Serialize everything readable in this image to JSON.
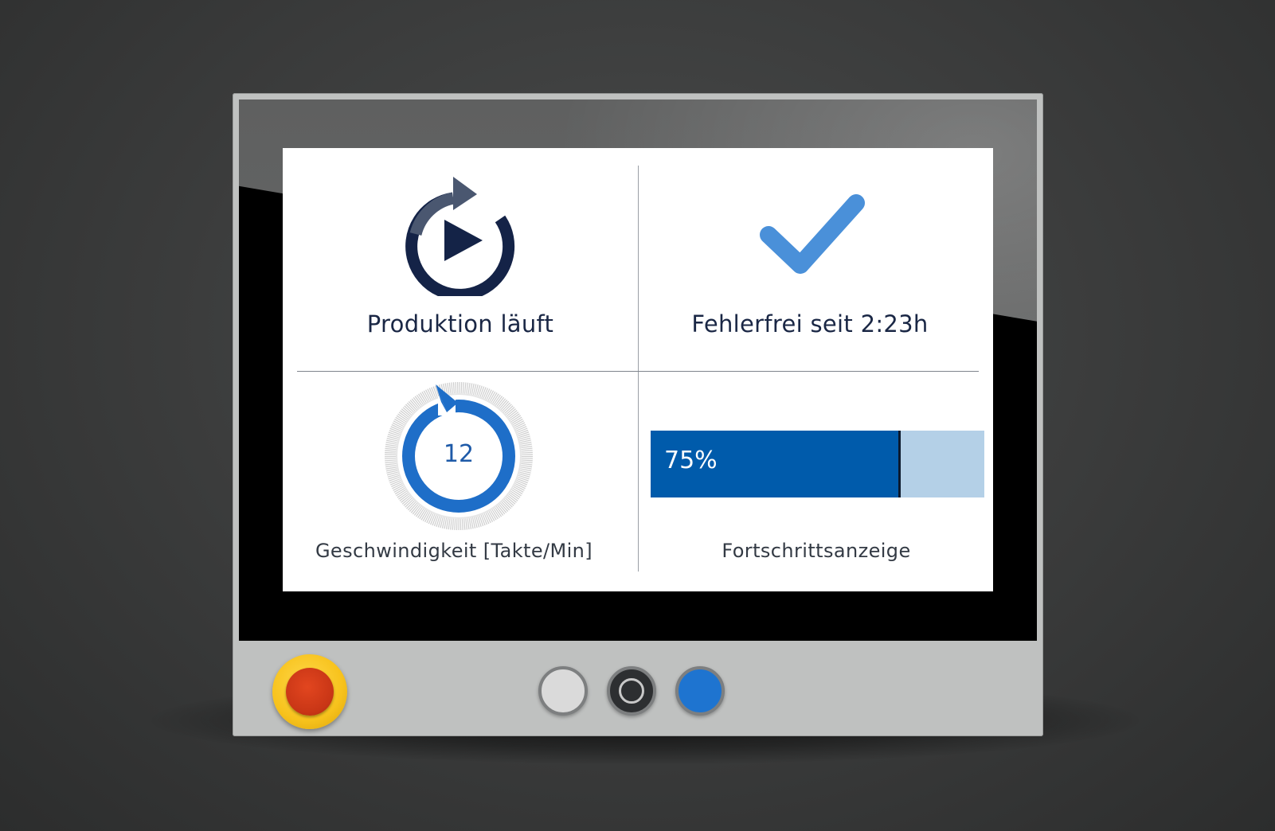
{
  "status": {
    "production_label": "Produktion läuft",
    "production_icon": "replay-play-icon",
    "error_free_label": "Fehlerfrei seit 2:23h",
    "error_free_icon": "checkmark-icon"
  },
  "speed": {
    "value": "12",
    "caption": "Geschwindigkeit [Takte/Min]"
  },
  "progress": {
    "value_percent": 75,
    "label": "75%",
    "caption": "Fortschrittsanzeige"
  },
  "hardware_buttons": [
    {
      "name": "emergency-stop-button",
      "color": "#c93616"
    },
    {
      "name": "white-button",
      "color": "#dadada"
    },
    {
      "name": "black-button",
      "color": "#2d2f31"
    },
    {
      "name": "blue-button",
      "color": "#1e74d0"
    }
  ],
  "colors": {
    "accent_blue": "#005bab",
    "accent_light_blue": "#b4d0e7",
    "check_blue": "#4a90d9",
    "navy": "#1a2745"
  }
}
